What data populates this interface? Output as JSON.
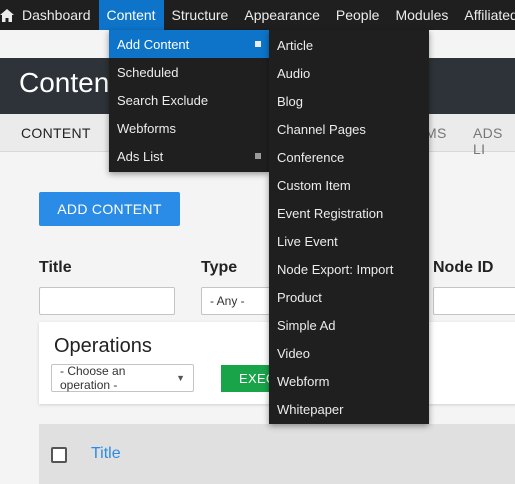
{
  "toolbar": {
    "items": [
      {
        "label": "Dashboard"
      },
      {
        "label": "Content"
      },
      {
        "label": "Structure"
      },
      {
        "label": "Appearance"
      },
      {
        "label": "People"
      },
      {
        "label": "Modules"
      },
      {
        "label": "Affiliated C"
      }
    ],
    "active_item": "Content"
  },
  "page": {
    "title": "Content"
  },
  "tabs": [
    {
      "label": "CONTENT"
    },
    {
      "label": "MS"
    },
    {
      "label": "ADS LI"
    }
  ],
  "main": {
    "add_button": "ADD CONTENT",
    "filters": {
      "title_label": "Title",
      "type_label": "Type",
      "type_value": "- Any -",
      "nodeid_label": "Node ID"
    },
    "operations": {
      "title": "Operations",
      "select_value": "- Choose an operation -",
      "execute_label": "EXEC"
    },
    "table": {
      "title_header": "Title"
    }
  },
  "content_menu": {
    "items": [
      {
        "label": "Add Content"
      },
      {
        "label": "Scheduled"
      },
      {
        "label": "Search Exclude"
      },
      {
        "label": "Webforms"
      },
      {
        "label": "Ads List"
      }
    ]
  },
  "add_content_menu": {
    "items": [
      {
        "label": "Article"
      },
      {
        "label": "Audio"
      },
      {
        "label": "Blog"
      },
      {
        "label": "Channel Pages"
      },
      {
        "label": "Conference"
      },
      {
        "label": "Custom Item"
      },
      {
        "label": "Event Registration"
      },
      {
        "label": "Live Event"
      },
      {
        "label": "Node Export: Import"
      },
      {
        "label": "Product"
      },
      {
        "label": "Simple Ad"
      },
      {
        "label": "Video"
      },
      {
        "label": "Webform"
      },
      {
        "label": "Whitepaper"
      }
    ]
  },
  "colors": {
    "toolbar_bg": "#1f1f1f",
    "accent_blue": "#0d74c9",
    "button_blue": "#2a8ce6",
    "execute_green": "#1aa44a",
    "title_band": "#2d3338"
  }
}
